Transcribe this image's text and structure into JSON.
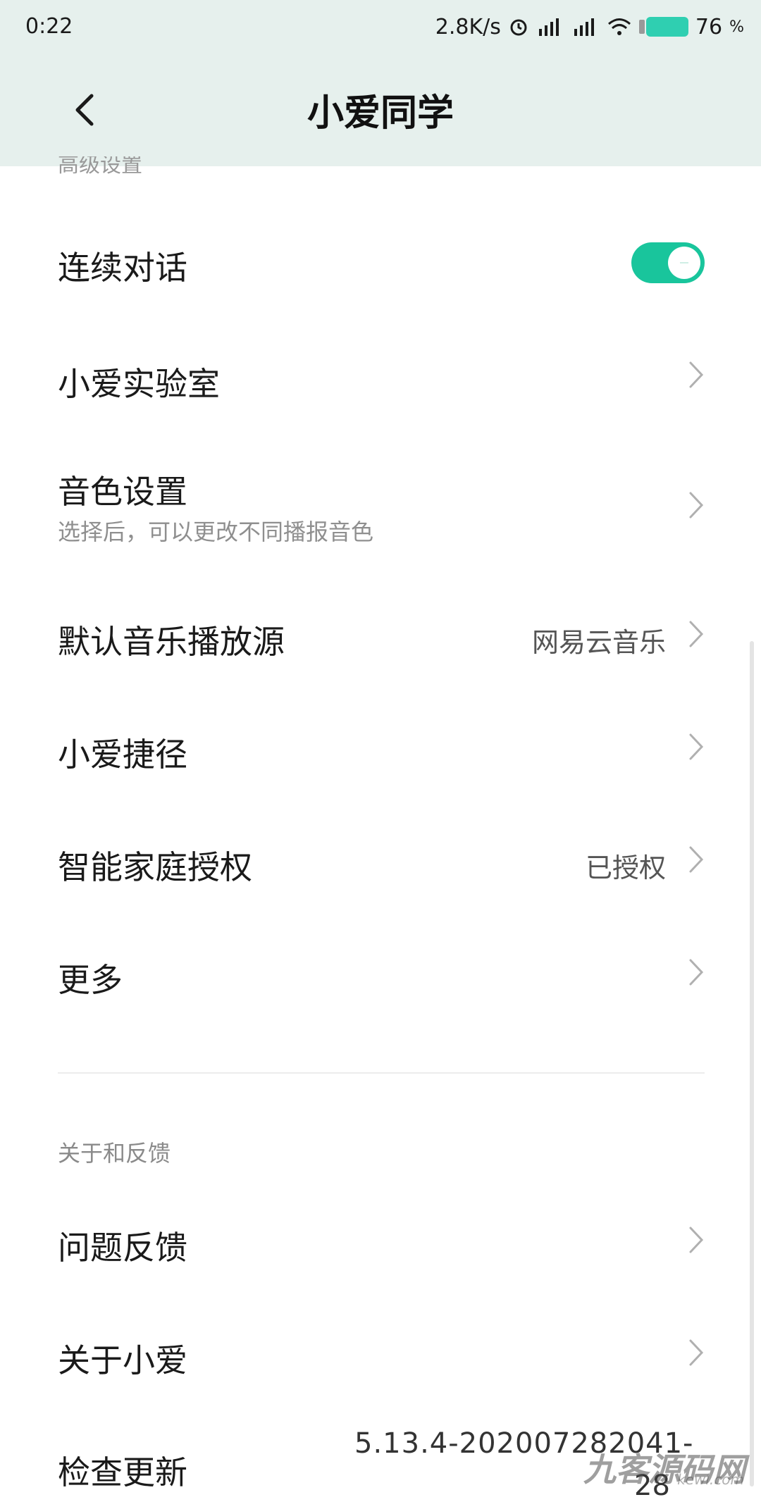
{
  "status_bar": {
    "time": "0:22",
    "net_speed": "2.8K/s",
    "battery_level": "76",
    "battery_unit": "%",
    "icons": [
      "alarm-icon",
      "signal-hd-icon",
      "signal-hd-icon",
      "wifi-icon",
      "battery-icon"
    ],
    "colors": {
      "battery": "#2fcfb1"
    }
  },
  "header": {
    "title": "小爱同学",
    "back_icon": "chevron-left-icon"
  },
  "sections": {
    "advanced_label_partial": "高级设置",
    "about_label": "关于和反馈"
  },
  "rows": {
    "continuous_dialog": {
      "title": "连续对话",
      "toggle_on": true
    },
    "lab": {
      "title": "小爱实验室"
    },
    "voice": {
      "title": "音色设置",
      "subtitle": "选择后，可以更改不同播报音色"
    },
    "music_source": {
      "title": "默认音乐播放源",
      "value": "网易云音乐"
    },
    "shortcut": {
      "title": "小爱捷径"
    },
    "smart_home": {
      "title": "智能家庭授权",
      "value": "已授权"
    },
    "more": {
      "title": "更多"
    },
    "feedback": {
      "title": "问题反馈"
    },
    "about": {
      "title": "关于小爱"
    },
    "update": {
      "title": "检查更新",
      "value_line1": "5.13.4-202007282041-",
      "value_line2": "28"
    }
  },
  "watermark": {
    "text": "九客源码网",
    "sub": "kewl.com"
  },
  "colors": {
    "accent": "#19c59c",
    "header_bg": "#e6f0ed"
  }
}
